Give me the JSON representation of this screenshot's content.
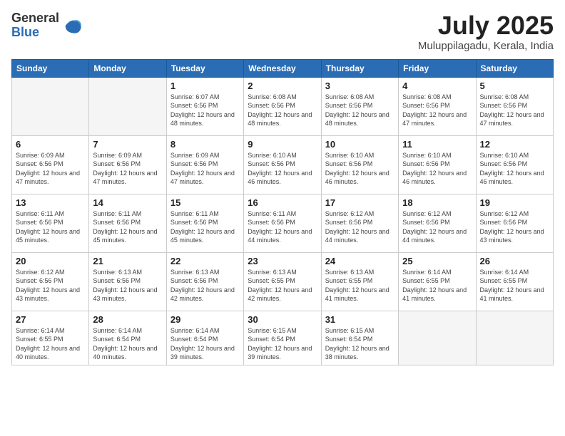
{
  "logo": {
    "general": "General",
    "blue": "Blue"
  },
  "header": {
    "month": "July 2025",
    "location": "Muluppilagadu, Kerala, India"
  },
  "days_of_week": [
    "Sunday",
    "Monday",
    "Tuesday",
    "Wednesday",
    "Thursday",
    "Friday",
    "Saturday"
  ],
  "weeks": [
    [
      {
        "day": "",
        "info": ""
      },
      {
        "day": "",
        "info": ""
      },
      {
        "day": "1",
        "info": "Sunrise: 6:07 AM\nSunset: 6:56 PM\nDaylight: 12 hours and 48 minutes."
      },
      {
        "day": "2",
        "info": "Sunrise: 6:08 AM\nSunset: 6:56 PM\nDaylight: 12 hours and 48 minutes."
      },
      {
        "day": "3",
        "info": "Sunrise: 6:08 AM\nSunset: 6:56 PM\nDaylight: 12 hours and 48 minutes."
      },
      {
        "day": "4",
        "info": "Sunrise: 6:08 AM\nSunset: 6:56 PM\nDaylight: 12 hours and 47 minutes."
      },
      {
        "day": "5",
        "info": "Sunrise: 6:08 AM\nSunset: 6:56 PM\nDaylight: 12 hours and 47 minutes."
      }
    ],
    [
      {
        "day": "6",
        "info": "Sunrise: 6:09 AM\nSunset: 6:56 PM\nDaylight: 12 hours and 47 minutes."
      },
      {
        "day": "7",
        "info": "Sunrise: 6:09 AM\nSunset: 6:56 PM\nDaylight: 12 hours and 47 minutes."
      },
      {
        "day": "8",
        "info": "Sunrise: 6:09 AM\nSunset: 6:56 PM\nDaylight: 12 hours and 47 minutes."
      },
      {
        "day": "9",
        "info": "Sunrise: 6:10 AM\nSunset: 6:56 PM\nDaylight: 12 hours and 46 minutes."
      },
      {
        "day": "10",
        "info": "Sunrise: 6:10 AM\nSunset: 6:56 PM\nDaylight: 12 hours and 46 minutes."
      },
      {
        "day": "11",
        "info": "Sunrise: 6:10 AM\nSunset: 6:56 PM\nDaylight: 12 hours and 46 minutes."
      },
      {
        "day": "12",
        "info": "Sunrise: 6:10 AM\nSunset: 6:56 PM\nDaylight: 12 hours and 46 minutes."
      }
    ],
    [
      {
        "day": "13",
        "info": "Sunrise: 6:11 AM\nSunset: 6:56 PM\nDaylight: 12 hours and 45 minutes."
      },
      {
        "day": "14",
        "info": "Sunrise: 6:11 AM\nSunset: 6:56 PM\nDaylight: 12 hours and 45 minutes."
      },
      {
        "day": "15",
        "info": "Sunrise: 6:11 AM\nSunset: 6:56 PM\nDaylight: 12 hours and 45 minutes."
      },
      {
        "day": "16",
        "info": "Sunrise: 6:11 AM\nSunset: 6:56 PM\nDaylight: 12 hours and 44 minutes."
      },
      {
        "day": "17",
        "info": "Sunrise: 6:12 AM\nSunset: 6:56 PM\nDaylight: 12 hours and 44 minutes."
      },
      {
        "day": "18",
        "info": "Sunrise: 6:12 AM\nSunset: 6:56 PM\nDaylight: 12 hours and 44 minutes."
      },
      {
        "day": "19",
        "info": "Sunrise: 6:12 AM\nSunset: 6:56 PM\nDaylight: 12 hours and 43 minutes."
      }
    ],
    [
      {
        "day": "20",
        "info": "Sunrise: 6:12 AM\nSunset: 6:56 PM\nDaylight: 12 hours and 43 minutes."
      },
      {
        "day": "21",
        "info": "Sunrise: 6:13 AM\nSunset: 6:56 PM\nDaylight: 12 hours and 43 minutes."
      },
      {
        "day": "22",
        "info": "Sunrise: 6:13 AM\nSunset: 6:56 PM\nDaylight: 12 hours and 42 minutes."
      },
      {
        "day": "23",
        "info": "Sunrise: 6:13 AM\nSunset: 6:55 PM\nDaylight: 12 hours and 42 minutes."
      },
      {
        "day": "24",
        "info": "Sunrise: 6:13 AM\nSunset: 6:55 PM\nDaylight: 12 hours and 41 minutes."
      },
      {
        "day": "25",
        "info": "Sunrise: 6:14 AM\nSunset: 6:55 PM\nDaylight: 12 hours and 41 minutes."
      },
      {
        "day": "26",
        "info": "Sunrise: 6:14 AM\nSunset: 6:55 PM\nDaylight: 12 hours and 41 minutes."
      }
    ],
    [
      {
        "day": "27",
        "info": "Sunrise: 6:14 AM\nSunset: 6:55 PM\nDaylight: 12 hours and 40 minutes."
      },
      {
        "day": "28",
        "info": "Sunrise: 6:14 AM\nSunset: 6:54 PM\nDaylight: 12 hours and 40 minutes."
      },
      {
        "day": "29",
        "info": "Sunrise: 6:14 AM\nSunset: 6:54 PM\nDaylight: 12 hours and 39 minutes."
      },
      {
        "day": "30",
        "info": "Sunrise: 6:15 AM\nSunset: 6:54 PM\nDaylight: 12 hours and 39 minutes."
      },
      {
        "day": "31",
        "info": "Sunrise: 6:15 AM\nSunset: 6:54 PM\nDaylight: 12 hours and 38 minutes."
      },
      {
        "day": "",
        "info": ""
      },
      {
        "day": "",
        "info": ""
      }
    ]
  ]
}
